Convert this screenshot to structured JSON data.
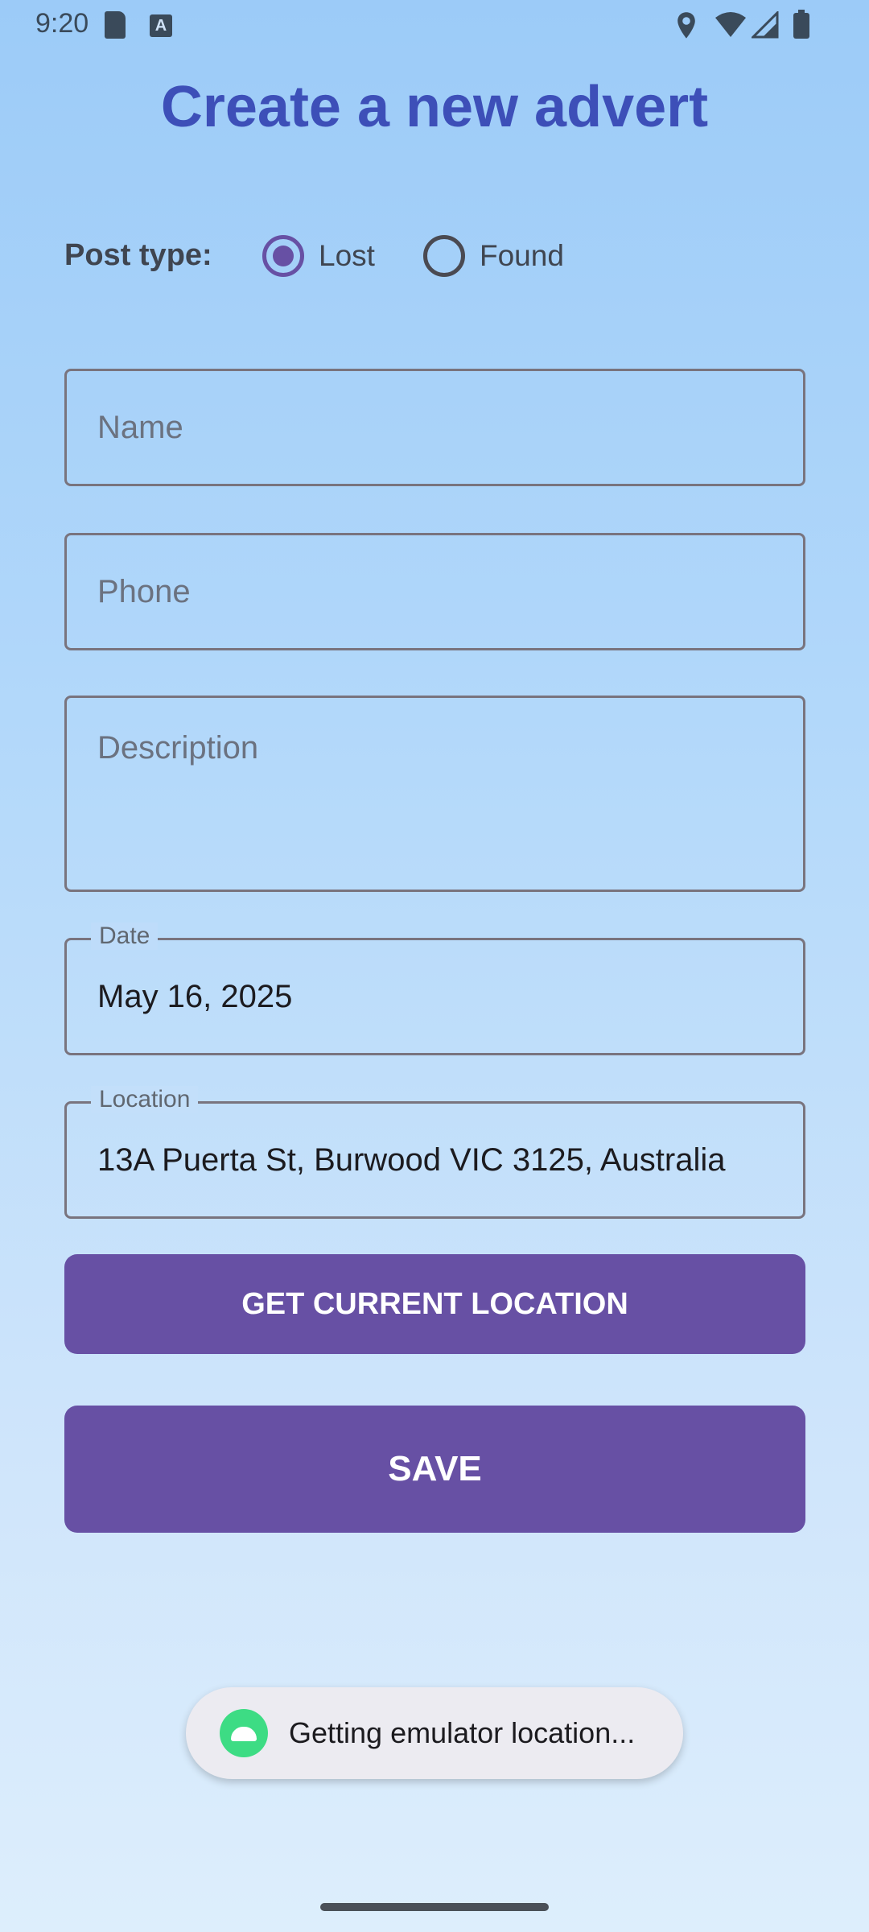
{
  "status_bar": {
    "time": "9:20",
    "icons": [
      "sd-card-icon",
      "text-a-icon",
      "location-icon",
      "wifi-icon",
      "signal-icon",
      "battery-icon"
    ],
    "sd_letter": "A"
  },
  "page": {
    "title": "Create a new advert"
  },
  "post_type": {
    "label": "Post type:",
    "options": [
      {
        "label": "Lost",
        "selected": true
      },
      {
        "label": "Found",
        "selected": false
      }
    ]
  },
  "form": {
    "name": {
      "placeholder": "Name",
      "value": ""
    },
    "phone": {
      "placeholder": "Phone",
      "value": ""
    },
    "description": {
      "placeholder": "Description",
      "value": ""
    },
    "date": {
      "label": "Date",
      "value": "May 16, 2025"
    },
    "location": {
      "label": "Location",
      "value": "13A Puerta St, Burwood VIC 3125, Australia"
    }
  },
  "buttons": {
    "get_location": "GET CURRENT LOCATION",
    "save": "SAVE"
  },
  "toast": {
    "text": "Getting emulator location...",
    "icon": "android-icon"
  },
  "colors": {
    "accent": "#6750a4",
    "title": "#3d4fb8",
    "background_top": "#9ccbf8",
    "background_bottom": "#ddeefc"
  }
}
